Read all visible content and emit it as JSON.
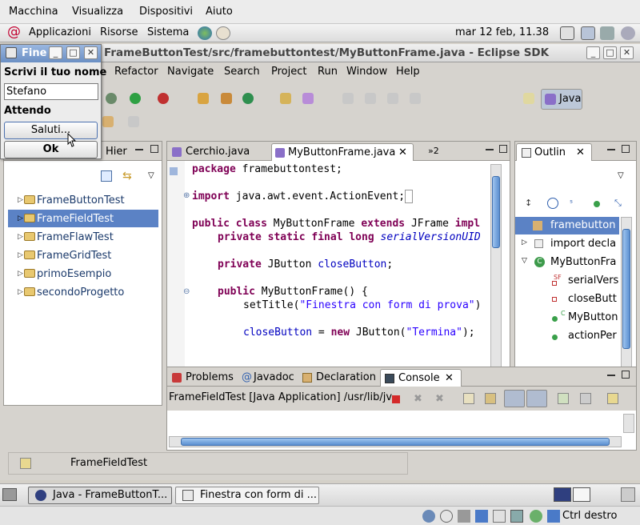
{
  "vbox_menu": {
    "items": [
      "Macchina",
      "Visualizza",
      "Dispositivi",
      "Aiuto"
    ]
  },
  "gnome_panel": {
    "menus": [
      "Applicazioni",
      "Risorse",
      "Sistema"
    ],
    "clock": "mar 12 feb, 11.38"
  },
  "eclipse": {
    "window_title": "FrameButtonTest/src/framebuttontest/MyButtonFrame.java - Eclipse SDK",
    "menu": [
      "Refactor",
      "Navigate",
      "Search",
      "Project",
      "Run",
      "Window",
      "Help"
    ],
    "perspective": "Java"
  },
  "package_explorer": {
    "tab_label": "Hier",
    "items": [
      {
        "label": "FrameButtonTest",
        "selected": false
      },
      {
        "label": "FrameFieldTest",
        "selected": true
      },
      {
        "label": "FrameFlawTest",
        "selected": false
      },
      {
        "label": "FrameGridTest",
        "selected": false
      },
      {
        "label": "primoEsempio",
        "selected": false
      },
      {
        "label": "secondoProgetto",
        "selected": false
      }
    ]
  },
  "editor": {
    "tabs": [
      {
        "label": "Cerchio.java"
      },
      {
        "label": "MyButtonFrame.java"
      }
    ],
    "overflow_label": "»2"
  },
  "outline": {
    "tab_label": "Outlin",
    "items": [
      "framebutton",
      "import decla",
      "MyButtonFra",
      "serialVers",
      "closeButt",
      "MyButton",
      "actionPer"
    ],
    "markers": [
      "SF",
      "C"
    ]
  },
  "bottom_panel": {
    "tabs": [
      "Problems",
      "Javadoc",
      "Declaration",
      "Console"
    ],
    "console_header": "FrameFieldTest [Java Application] /usr/lib/jv"
  },
  "status": {
    "project": "FrameFieldTest"
  },
  "dialog": {
    "title": "Fine",
    "prompt": "Scrivi il tuo nome",
    "input_value": "Stefano",
    "status": "Attendo",
    "greet_button": "Saluti...",
    "ok_button": "Ok"
  },
  "taskbar": {
    "items": [
      "Java - FrameButtonT...",
      "Finestra con form di ..."
    ]
  },
  "vbox_status": {
    "host_key": "Ctrl destro"
  }
}
